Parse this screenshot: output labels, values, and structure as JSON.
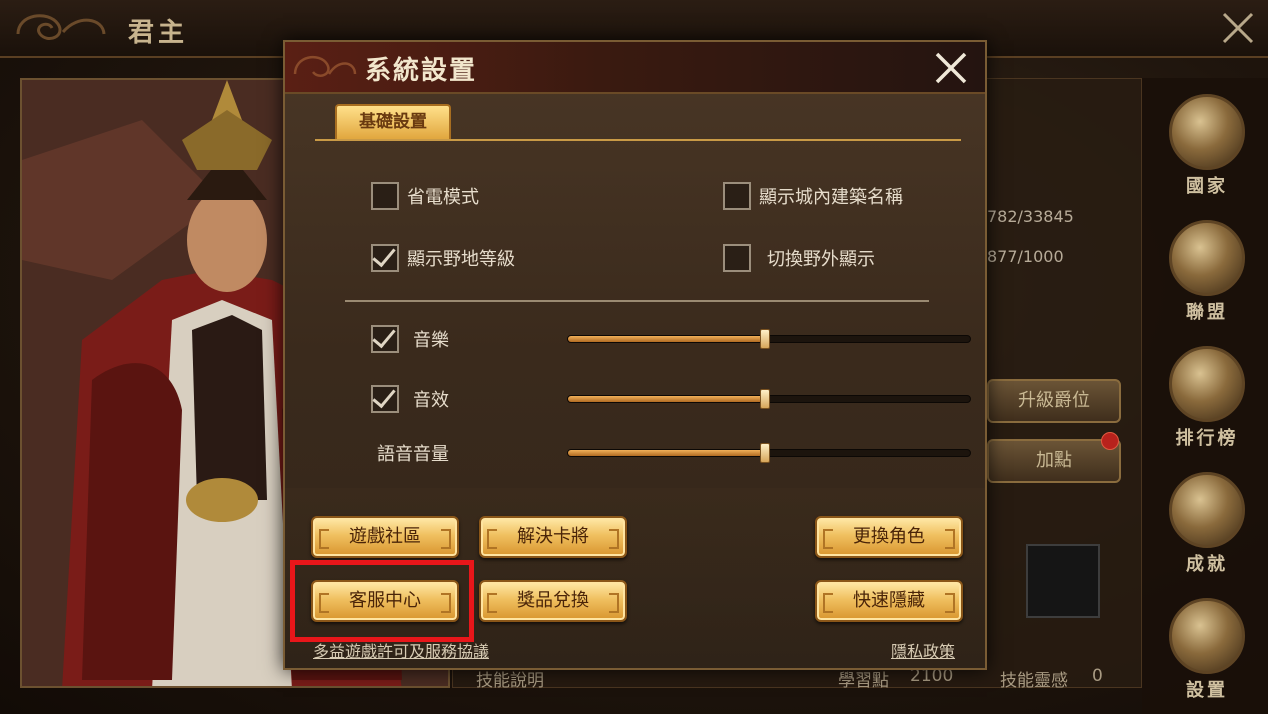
{
  "background": {
    "title": "君主",
    "stats": [
      "782/33845",
      "877/1000"
    ],
    "buttons": {
      "upgrade": "升級爵位",
      "add_points": "加點"
    },
    "bottom": {
      "skill_desc": "技能說明",
      "learn_points_label": "學習點",
      "learn_points_value": "2100",
      "skill_insight_label": "技能靈感",
      "skill_insight_value": "0"
    },
    "side_nav": [
      "國家",
      "聯盟",
      "排行榜",
      "成就",
      "設置"
    ]
  },
  "modal": {
    "title": "系統設置",
    "tab": "基礎設置",
    "checkboxes": [
      {
        "label": "省電模式",
        "checked": false
      },
      {
        "label": "顯示城內建築名稱",
        "checked": false
      },
      {
        "label": "顯示野地等級",
        "checked": true
      },
      {
        "label": "切換野外顯示",
        "checked": false
      }
    ],
    "sliders": [
      {
        "label": "音樂",
        "has_checkbox": true,
        "checked": true,
        "level": 0.49
      },
      {
        "label": "音效",
        "has_checkbox": true,
        "checked": true,
        "level": 0.49
      },
      {
        "label": "語音音量",
        "has_checkbox": false,
        "level": 0.49
      }
    ],
    "buttons": {
      "community": "遊戲社區",
      "fix_stuck": "解決卡將",
      "change_role": "更換角色",
      "support": "客服中心",
      "redeem": "獎品兌換",
      "quick_hide": "快速隱藏"
    },
    "links": {
      "license": "多益遊戲許可及服務協議",
      "privacy": "隱私政策"
    }
  },
  "colors": {
    "highlight": "#e8161a",
    "button_gold": "#f0c060",
    "slider_fill": "#d8902e"
  }
}
